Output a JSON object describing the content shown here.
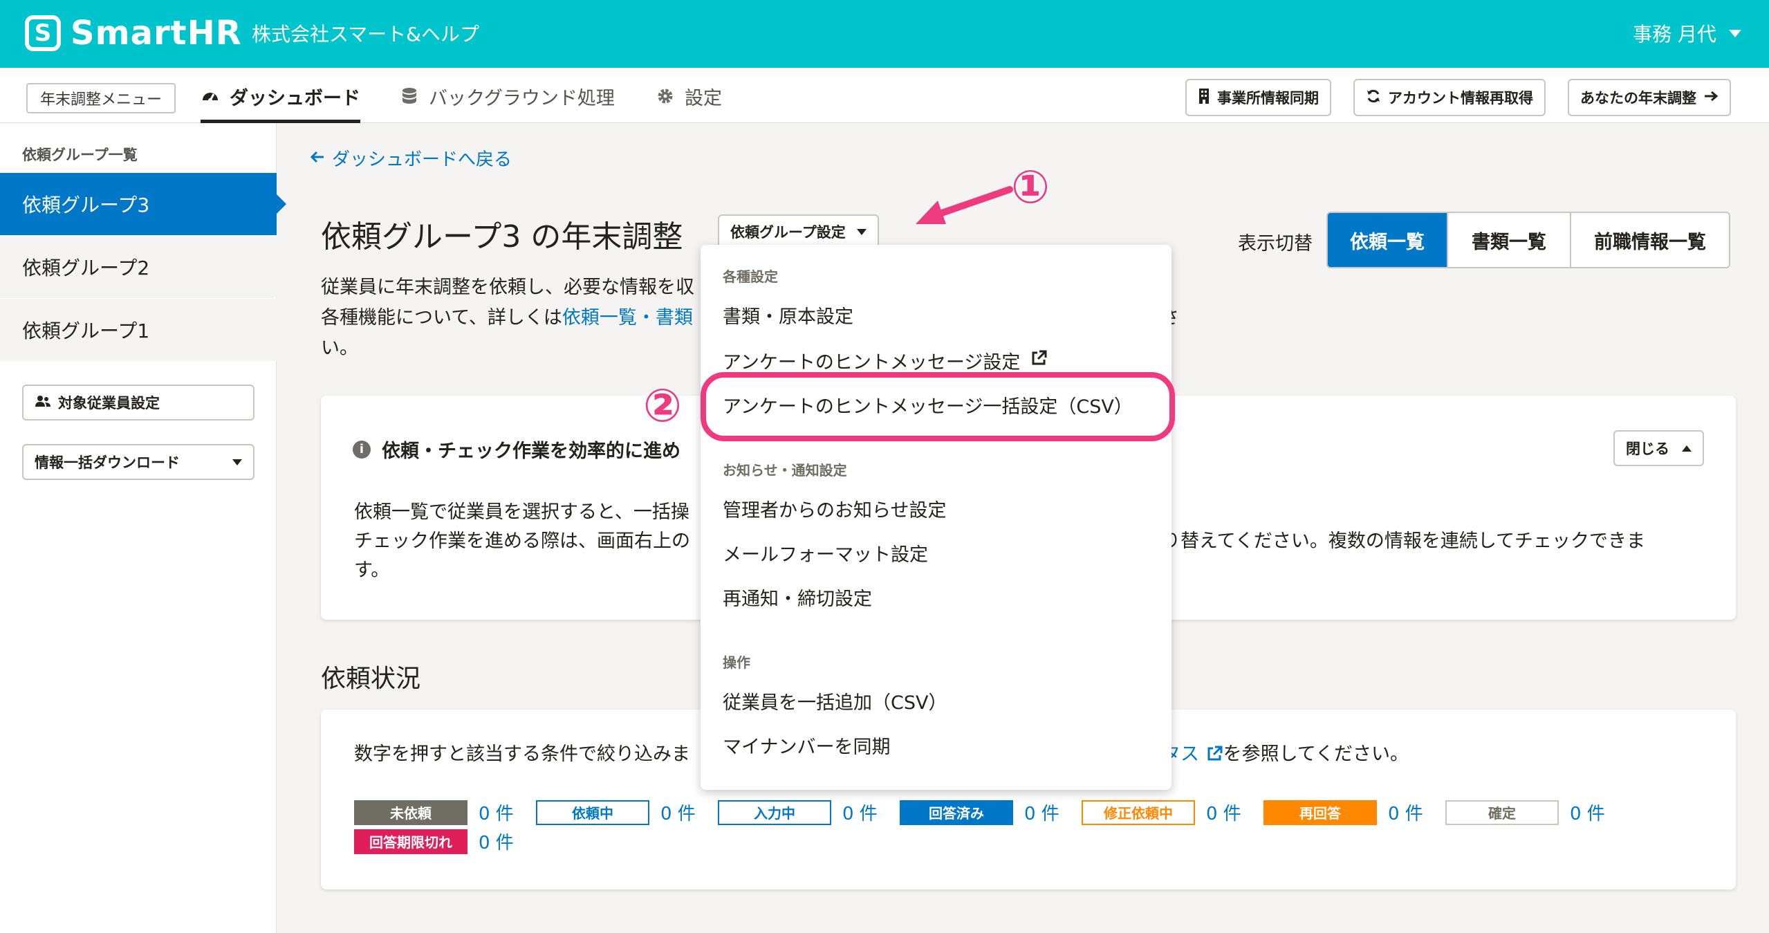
{
  "header": {
    "logo_mark": "S",
    "logo_text": "SmartHR",
    "company": "株式会社スマート&ヘルプ",
    "user": "事務 月代"
  },
  "subnav": {
    "menu_label": "年末調整メニュー",
    "tabs": [
      {
        "label": "ダッシュボード",
        "icon": "dashboard-icon"
      },
      {
        "label": "バックグラウンド処理",
        "icon": "database-icon"
      },
      {
        "label": "設定",
        "icon": "gear-icon"
      }
    ],
    "buttons": [
      {
        "label": "事業所情報同期",
        "icon": "building-icon"
      },
      {
        "label": "アカウント情報再取得",
        "icon": "refresh-icon"
      },
      {
        "label": "あなたの年末調整",
        "icon": "arrow-right-icon"
      }
    ]
  },
  "sidebar": {
    "heading": "依頼グループ一覧",
    "items": [
      "依頼グループ3",
      "依頼グループ2",
      "依頼グループ1"
    ],
    "target_button": "対象従業員設定",
    "download_button": "情報一括ダウンロード"
  },
  "main": {
    "back_link": "ダッシュボードへ戻る",
    "title": "依頼グループ3 の年末調整",
    "group_settings_button": "依頼グループ設定",
    "switch_label": "表示切替",
    "segments": [
      "依頼一覧",
      "書類一覧",
      "前職情報一覧"
    ],
    "desc_line1": "従業員に年末調整を依頼し、必要な情報を収",
    "desc_line2_prefix": "各種機能について、詳しくは",
    "desc_line2_link": "依頼一覧・書類",
    "desc_line2_tail": "さ",
    "desc_line3": "い。"
  },
  "info_card": {
    "title": "依頼・チェック作業を効率的に進め",
    "close_label": "閉じる",
    "line1": "依頼一覧で従業員を選択すると、一括操",
    "line2_left": "チェック作業を進める際は、画面右上の",
    "line2_right": "り替えてください。複数の情報を連続してチェックできま",
    "line3": "す。"
  },
  "status_section": {
    "title": "依頼状況",
    "note_left": "数字を押すと該当する条件で絞り込みま",
    "note_link": "タス",
    "note_right": "を参照してください。",
    "statuses": [
      {
        "label": "未依頼",
        "count": "0 件",
        "style": "gray"
      },
      {
        "label": "依頼中",
        "count": "0 件",
        "style": "outline-blue"
      },
      {
        "label": "入力中",
        "count": "0 件",
        "style": "outline-blue"
      },
      {
        "label": "回答済み",
        "count": "0 件",
        "style": "blue"
      },
      {
        "label": "修正依頼中",
        "count": "0 件",
        "style": "outline-orange"
      },
      {
        "label": "再回答",
        "count": "0 件",
        "style": "orange"
      },
      {
        "label": "確定",
        "count": "0 件",
        "style": "outline-gray"
      },
      {
        "label": "回答期限切れ",
        "count": "0 件",
        "style": "red"
      }
    ]
  },
  "dropdown": {
    "head1": "各種設定",
    "item1": "書類・原本設定",
    "item2": "アンケートのヒントメッセージ設定",
    "item3": "アンケートのヒントメッセージ一括設定（CSV）",
    "head2": "お知らせ・通知設定",
    "item4": "管理者からのお知らせ設定",
    "item5": "メールフォーマット設定",
    "item6": "再通知・締切設定",
    "head3": "操作",
    "item7": "従業員を一括追加（CSV）",
    "item8": "マイナンバーを同期"
  },
  "annotations": {
    "step1": "①",
    "step2": "②"
  },
  "colors": {
    "brand": "#00c4cc",
    "accent": "#0077c7",
    "highlight": "#ee3b7f",
    "status_gray": "#706d65",
    "status_orange": "#ff8800",
    "status_red": "#e01e5a"
  }
}
